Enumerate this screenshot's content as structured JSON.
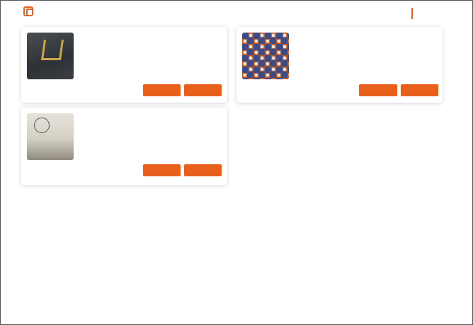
{
  "header": {
    "brand": "",
    "nav_label": ""
  },
  "colors": {
    "accent": "#e8601c",
    "card_background": "#ffffff",
    "page_background": "#ffffff"
  },
  "cards": [
    {
      "title": "",
      "description": "",
      "price": "",
      "image_icon": "dark-garment-image",
      "buttons": [
        "",
        ""
      ]
    },
    {
      "title": "",
      "description": "",
      "price": "",
      "image_icon": "patterned-fabric-image",
      "buttons": [
        "",
        ""
      ]
    },
    {
      "title": "",
      "description": "",
      "price": "",
      "image_icon": "white-garment-image",
      "buttons": [
        "",
        ""
      ]
    }
  ]
}
